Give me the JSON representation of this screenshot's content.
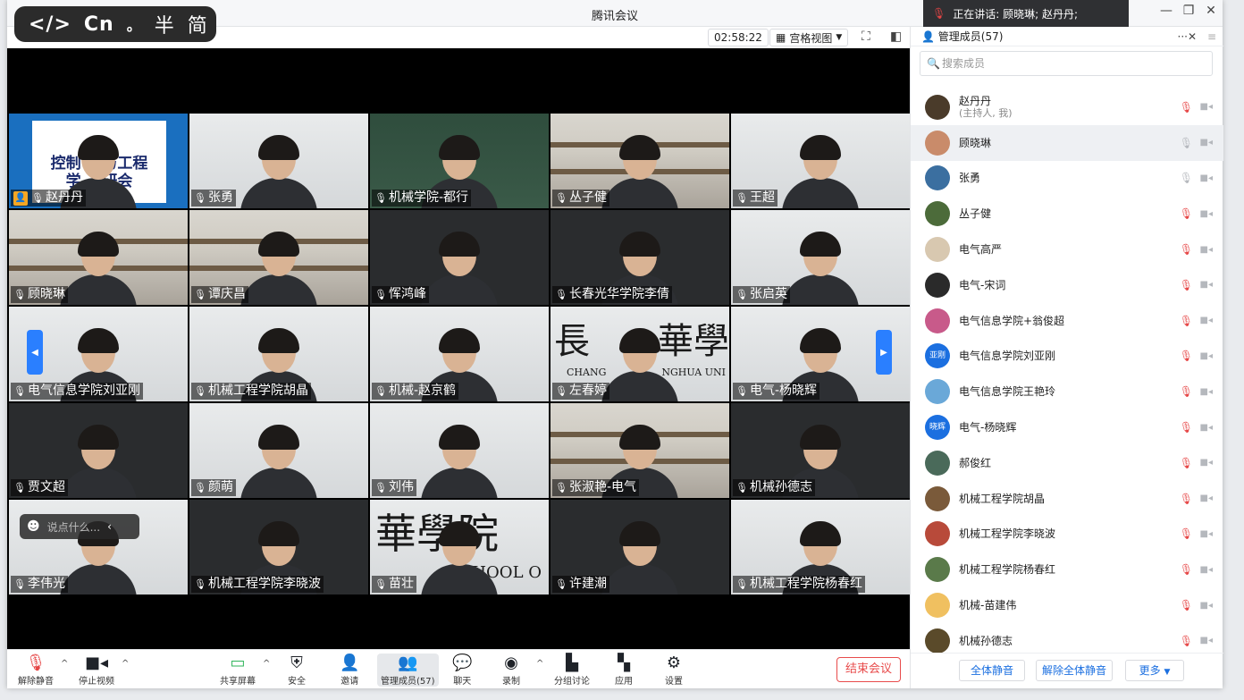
{
  "window": {
    "title": "腾讯会议"
  },
  "overlay": {
    "code": "</>",
    "cn": "Cn",
    "dot": "。",
    "half": "半",
    "simp": "简"
  },
  "speaking": {
    "text": "正在讲话: 顾晓琳; 赵丹丹;"
  },
  "toolbar_top": {
    "timer": "02:58:22",
    "view": "宫格视图"
  },
  "tiles": [
    {
      "name": "赵丹丹",
      "host": true
    },
    {
      "name": "张勇"
    },
    {
      "name": "机械学院-都行"
    },
    {
      "name": "丛子健"
    },
    {
      "name": "王超"
    },
    {
      "name": "顾晓琳"
    },
    {
      "name": "谭庆昌"
    },
    {
      "name": "恽鸿峰"
    },
    {
      "name": "长春光华学院李倩"
    },
    {
      "name": "张启英"
    },
    {
      "name": "电气信息学院刘亚刚"
    },
    {
      "name": "机械工程学院胡晶"
    },
    {
      "name": "机械-赵京鹤"
    },
    {
      "name": "左春婷"
    },
    {
      "name": "电气-杨晓辉"
    },
    {
      "name": "贾文超"
    },
    {
      "name": "颜萌"
    },
    {
      "name": "刘伟"
    },
    {
      "name": "张淑艳-电气"
    },
    {
      "name": "机械孙德志"
    },
    {
      "name": "李伟光"
    },
    {
      "name": "机械工程学院李晓波"
    },
    {
      "name": "苗壮"
    },
    {
      "name": "许建潮"
    },
    {
      "name": "机械工程学院杨春红"
    }
  ],
  "sign": {
    "line1": "控制",
    "line1b": "与工程",
    "line2": "学",
    "line2b": "研会"
  },
  "school_sign": {
    "chars": "華學院",
    "text": "SCHOOL O"
  },
  "chang_sign": {
    "chars": "長",
    "chars2": "華學",
    "text": "CHANG",
    "text2": "NGHUA UNI"
  },
  "chat": {
    "placeholder": "说点什么..."
  },
  "bottombar": {
    "unmute": "解除静音",
    "stop_video": "停止视频",
    "share": "共享屏幕",
    "security": "安全",
    "invite": "邀请",
    "members": "管理成员(57)",
    "chat": "聊天",
    "record": "录制",
    "breakout": "分组讨论",
    "apps": "应用",
    "settings": "设置",
    "end": "结束会议"
  },
  "panel": {
    "title": "管理成员(57)",
    "search_placeholder": "搜索成员",
    "members": [
      {
        "name": "赵丹丹",
        "sub": "(主持人, 我)",
        "mic": "off",
        "color": "#4a3b2a"
      },
      {
        "name": "顾晓琳",
        "mic": "on",
        "color": "#c98b6a"
      },
      {
        "name": "张勇",
        "mic": "on",
        "color": "#3b6fa0"
      },
      {
        "name": "丛子健",
        "mic": "off",
        "color": "#4c6b3a"
      },
      {
        "name": "电气高严",
        "mic": "off",
        "color": "#d8c8b0"
      },
      {
        "name": "电气-宋词",
        "mic": "off",
        "color": "#2a2a2a"
      },
      {
        "name": "电气信息学院+翁俊超",
        "mic": "off",
        "color": "#c85a8a"
      },
      {
        "name": "电气信息学院刘亚刚",
        "mic": "off",
        "color": "#1b6fe0",
        "initials": "亚刚"
      },
      {
        "name": "电气信息学院王艳玲",
        "mic": "off",
        "color": "#6aa8d8"
      },
      {
        "name": "电气-杨晓辉",
        "mic": "off",
        "color": "#1b6fe0",
        "initials": "晓辉"
      },
      {
        "name": "郝俊红",
        "mic": "off",
        "color": "#4a6a5a"
      },
      {
        "name": "机械工程学院胡晶",
        "mic": "off",
        "color": "#7a5a3a"
      },
      {
        "name": "机械工程学院李晓波",
        "mic": "off",
        "color": "#b84a3a"
      },
      {
        "name": "机械工程学院杨春红",
        "mic": "off",
        "color": "#5a7a4a"
      },
      {
        "name": "机械-苗建伟",
        "mic": "off",
        "color": "#f0c060"
      },
      {
        "name": "机械孙德志",
        "mic": "off",
        "color": "#5a4a2a"
      }
    ],
    "mute_all": "全体静音",
    "unmute_all": "解除全体静音",
    "more": "更多"
  }
}
